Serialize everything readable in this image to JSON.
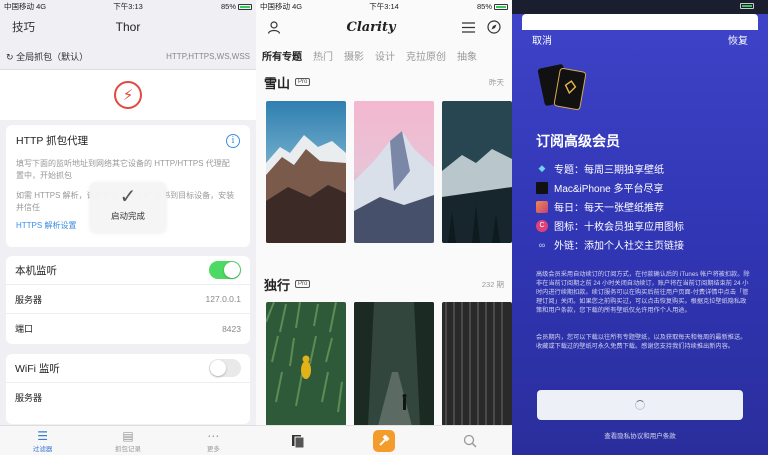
{
  "thor": {
    "status": {
      "carrier": "中国移动",
      "network": "4G",
      "time": "下午3:13",
      "battery": "85%"
    },
    "nav": {
      "left": "技巧",
      "title": "Thor"
    },
    "capture": {
      "label": "全局抓包（默认）",
      "protocols": "HTTP,HTTPS,WS,WSS"
    },
    "http_card": {
      "title": "HTTP 抓包代理",
      "desc": "填写下面的监听地址到网络其它设备的 HTTP/HTTPS 代理配置中，开始抓包",
      "desc2": "如需 HTTPS 解析，请先安装 SSL CA\" 证书到目标设备，安装并信任",
      "link": "HTTPS 解析设置"
    },
    "toast": {
      "text": "启动完成"
    },
    "local": {
      "title": "本机监听",
      "server_label": "服务器",
      "server_value": "127.0.0.1",
      "port_label": "端口",
      "port_value": "8423"
    },
    "wifi": {
      "title": "WiFi 监听",
      "server_label": "服务器"
    },
    "tabs": {
      "t1": "过滤器",
      "t2": "抓包记录",
      "t3": "更多"
    }
  },
  "clarity": {
    "status": {
      "carrier": "中国移动",
      "network": "4G",
      "time": "下午3:14",
      "battery": "85%"
    },
    "app_title": "Clarity",
    "categories": [
      "所有专题",
      "热门",
      "摄影",
      "设计",
      "克拉原创",
      "抽象"
    ],
    "sections": [
      {
        "title": "雪山",
        "badge": "Pro",
        "meta": "昨天"
      },
      {
        "title": "独行",
        "badge": "Pro",
        "meta": "232 期"
      }
    ]
  },
  "subscribe": {
    "nav": {
      "cancel": "取消",
      "restore": "恢复"
    },
    "title": "订阅高级会员",
    "features": [
      {
        "icon": "diamond-icon",
        "text": "专题：每周三期独享壁纸"
      },
      {
        "icon": "laptop-icon",
        "text": "Mac&iPhone 多平台尽享"
      },
      {
        "icon": "daily-icon",
        "text": "每日：每天一张壁纸推荐"
      },
      {
        "icon": "app-icon",
        "text": "图标：十枚会员独享应用图标"
      },
      {
        "icon": "link-icon",
        "text": "外链：添加个人社交主页链接"
      }
    ],
    "fine1": "高级会员采用自动续订的订阅方式，在付款确认后的 iTunes 帐户将被扣款。除非在当前订阅期之前 24 小时关闭自动续订，账户将在当前订阅期结束前 24 小时内进行续期扣款。续订服务可以在购买后前往用户页面-付费详情中点击「管理订阅」关闭。如果您之前购买过，可以点击恢复购买。根据克拉壁纸隐私政策和用户条款，您下载的所有壁纸仅允许用作个人用途。",
    "fine2": "会员期内，您可以下载以往所有专题壁纸，以及获取每天和每周的最新推送。收藏或下载过的壁纸可永久免费下载。感谢您支持我们持续推出新内容。",
    "privacy": "查看隐私协议和用户条款"
  }
}
